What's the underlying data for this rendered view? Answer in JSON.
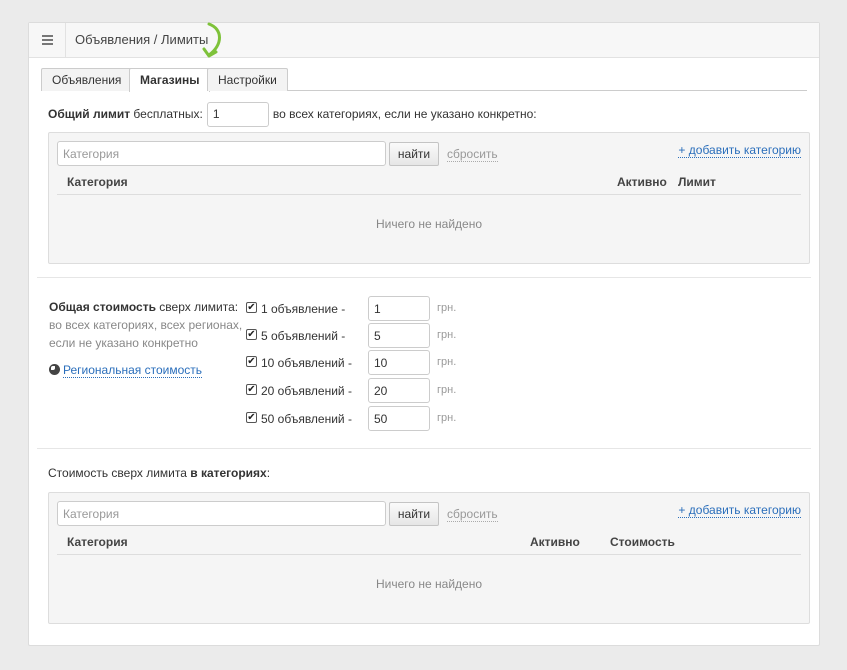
{
  "breadcrumb": "Объявления / Лимиты",
  "icons": {
    "menu": "hamburger-icon",
    "arrow": "green-arrow-icon",
    "globe": "globe-icon",
    "check": "checkbox-checked-icon"
  },
  "colors": {
    "link": "#2a6ebb",
    "arrow": "#7ec23a"
  },
  "tabs": [
    {
      "label": "Объявления",
      "active": false
    },
    {
      "label": "Магазины",
      "active": true
    },
    {
      "label": "Настройки",
      "active": false
    }
  ],
  "limit": {
    "label_bold": "Общий лимит",
    "label_rest": " бесплатных:",
    "value": "1",
    "suffix": "во всех категориях, если не указано конкретно:"
  },
  "limits_table": {
    "search_placeholder": "Категория",
    "find_label": "найти",
    "reset_label": "сбросить",
    "add_label": "+ добавить категорию",
    "columns": [
      "Категория",
      "Активно",
      "Лимит"
    ],
    "empty": "Ничего не найдено"
  },
  "cost": {
    "title_bold": "Общая стоимость",
    "title_rest": " сверх лимита:",
    "line2": "во всех категориях, всех регионах,",
    "line3": "если не указано конкретно",
    "regional_link": "Региональная стоимость",
    "tiers": [
      {
        "label": "1 объявление -",
        "value": "1",
        "unit": "грн.",
        "checked": true
      },
      {
        "label": "5 объявлений -",
        "value": "5",
        "unit": "грн.",
        "checked": true
      },
      {
        "label": "10 объявлений -",
        "value": "10",
        "unit": "грн.",
        "checked": true
      },
      {
        "label": "20 объявлений -",
        "value": "20",
        "unit": "грн.",
        "checked": true
      },
      {
        "label": "50 объявлений -",
        "value": "50",
        "unit": "грн.",
        "checked": true
      }
    ]
  },
  "category_cost": {
    "title_rest": "Стоимость сверх лимита ",
    "title_bold": "в категориях",
    "title_colon": ":",
    "search_placeholder": "Категория",
    "find_label": "найти",
    "reset_label": "сбросить",
    "add_label": "+ добавить категорию",
    "columns": [
      "Категория",
      "Активно",
      "Стоимость"
    ],
    "empty": "Ничего не найдено"
  }
}
